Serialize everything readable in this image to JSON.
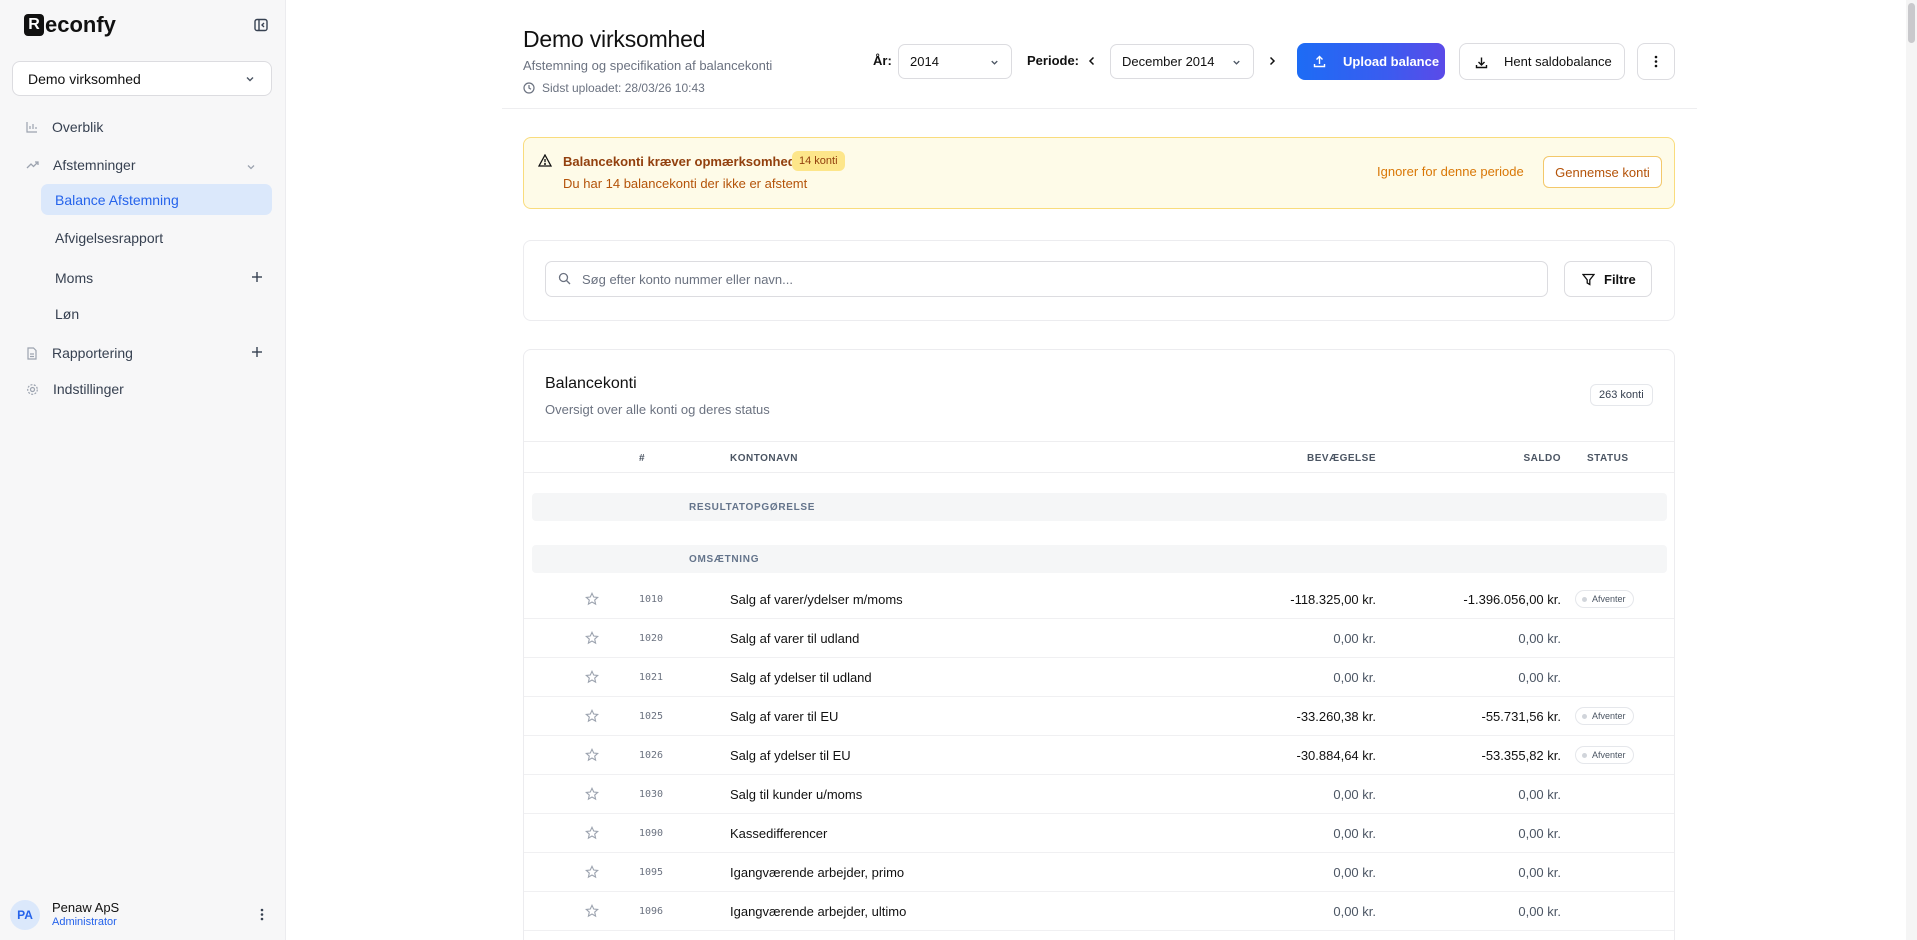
{
  "sidebar": {
    "logo_mark": "R",
    "logo_text": "econfy",
    "company": "Demo virksomhed",
    "nav": {
      "overview": "Overblik",
      "reconciliations": "Afstemninger",
      "balance_reconciliation": "Balance Afstemning",
      "deviation_report": "Afvigelsesrapport",
      "vat": "Moms",
      "payroll": "Løn",
      "reporting": "Rapportering",
      "settings": "Indstillinger"
    },
    "user": {
      "initials": "PA",
      "name": "Penaw ApS",
      "role": "Administrator"
    }
  },
  "header": {
    "title": "Demo virksomhed",
    "subtitle": "Afstemning og specifikation af balancekonti",
    "last_upload": "Sidst uploadet: 28/03/26 10:43",
    "year_label": "År:",
    "year_value": "2014",
    "period_label": "Periode:",
    "period_value": "December 2014",
    "upload_button": "Upload balance",
    "fetch_button": "Hent saldobalance"
  },
  "alert": {
    "title": "Balancekonti kræver opmærksomhed",
    "badge": "14 konti",
    "description": "Du har 14 balancekonti der ikke er afstemt",
    "ignore_link": "Ignorer for denne periode",
    "review_button": "Gennemse konti"
  },
  "search": {
    "placeholder": "Søg efter konto nummer eller navn...",
    "filter_button": "Filtre"
  },
  "table": {
    "title": "Balancekonti",
    "subtitle": "Oversigt over alle konti og deres status",
    "count": "263 konti",
    "columns": {
      "num": "#",
      "name": "KONTONAVN",
      "movement": "BEVÆGELSE",
      "balance": "SALDO",
      "status": "STATUS"
    },
    "groups": [
      "RESULTATOPGØRELSE",
      "OMSÆTNING"
    ],
    "rows": [
      {
        "num": "1010",
        "name": "Salg af varer/ydelser m/moms",
        "movement": "-118.325,00 kr.",
        "balance": "-1.396.056,00 kr.",
        "status": "Afventer"
      },
      {
        "num": "1020",
        "name": "Salg af varer til udland",
        "movement": "0,00 kr.",
        "balance": "0,00 kr.",
        "status": ""
      },
      {
        "num": "1021",
        "name": "Salg af ydelser til udland",
        "movement": "0,00 kr.",
        "balance": "0,00 kr.",
        "status": ""
      },
      {
        "num": "1025",
        "name": "Salg af varer til EU",
        "movement": "-33.260,38 kr.",
        "balance": "-55.731,56 kr.",
        "status": "Afventer"
      },
      {
        "num": "1026",
        "name": "Salg af ydelser til EU",
        "movement": "-30.884,64 kr.",
        "balance": "-53.355,82 kr.",
        "status": "Afventer"
      },
      {
        "num": "1030",
        "name": "Salg til kunder u/moms",
        "movement": "0,00 kr.",
        "balance": "0,00 kr.",
        "status": ""
      },
      {
        "num": "1090",
        "name": "Kassedifferencer",
        "movement": "0,00 kr.",
        "balance": "0,00 kr.",
        "status": ""
      },
      {
        "num": "1095",
        "name": "Igangværende arbejder, primo",
        "movement": "0,00 kr.",
        "balance": "0,00 kr.",
        "status": ""
      },
      {
        "num": "1096",
        "name": "Igangværende arbejder, ultimo",
        "movement": "0,00 kr.",
        "balance": "0,00 kr.",
        "status": ""
      }
    ]
  }
}
